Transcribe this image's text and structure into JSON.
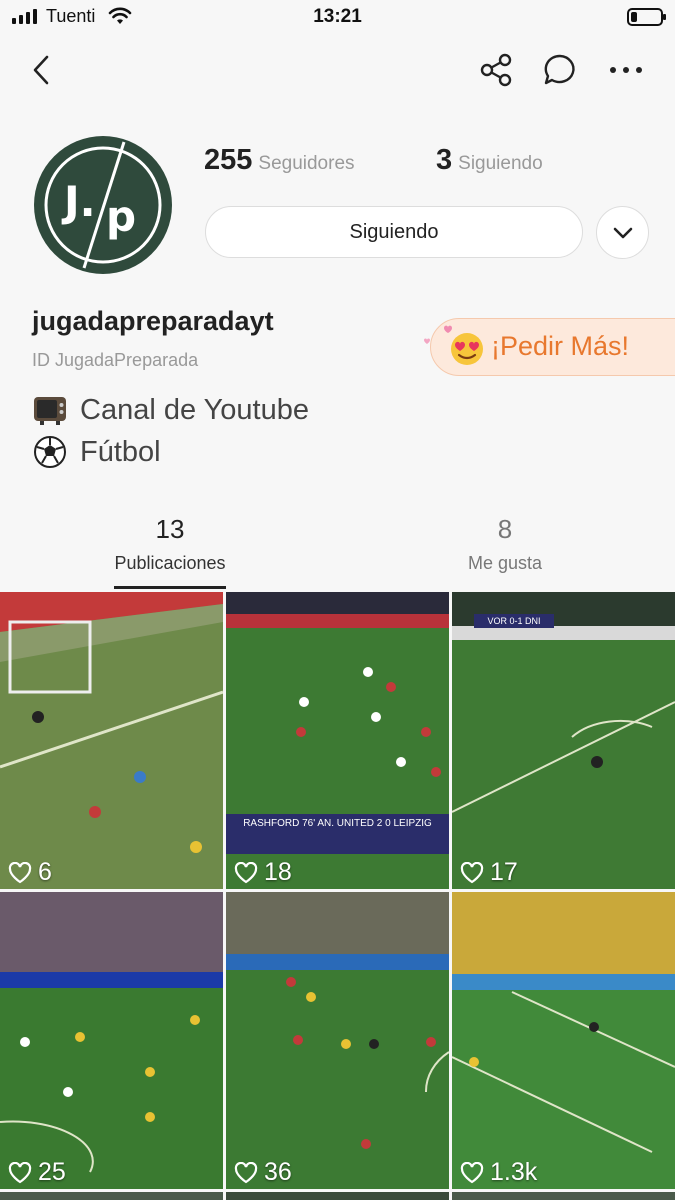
{
  "status_bar": {
    "carrier": "Tuenti",
    "time": "13:21",
    "battery_level": 0.2
  },
  "nav": {
    "icons": [
      "back-icon",
      "share-icon",
      "chat-icon",
      "more-icon"
    ]
  },
  "profile": {
    "followers_count": "255",
    "followers_label": "Seguidores",
    "following_count": "3",
    "following_label": "Siguiendo",
    "follow_button_label": "Siguiendo",
    "username": "jugadapreparadayt",
    "user_id": "ID JugadaPreparada",
    "request_button_label": "¡Pedir Más!",
    "bio_lines": [
      {
        "icon": "tv-icon",
        "text": "Canal de Youtube"
      },
      {
        "icon": "soccer-ball-icon",
        "text": "Fútbol"
      }
    ]
  },
  "tabs": [
    {
      "count": "13",
      "label": "Publicaciones",
      "active": true
    },
    {
      "count": "8",
      "label": "Me gusta",
      "active": false
    }
  ],
  "posts": [
    {
      "likes": "6",
      "scoreboard": ""
    },
    {
      "likes": "18",
      "scoreboard": "RASHFORD 76'  AN. UNITED 2 0 LEIPZIG"
    },
    {
      "likes": "17",
      "scoreboard": "VOR 0-1 DNI"
    },
    {
      "likes": "25",
      "scoreboard": ""
    },
    {
      "likes": "36",
      "scoreboard": ""
    },
    {
      "likes": "1.3k",
      "scoreboard": ""
    }
  ],
  "colors": {
    "accent_orange": "#e8782e",
    "avatar_green": "#2f4a3c",
    "pitch_green": "#3f7a34"
  }
}
